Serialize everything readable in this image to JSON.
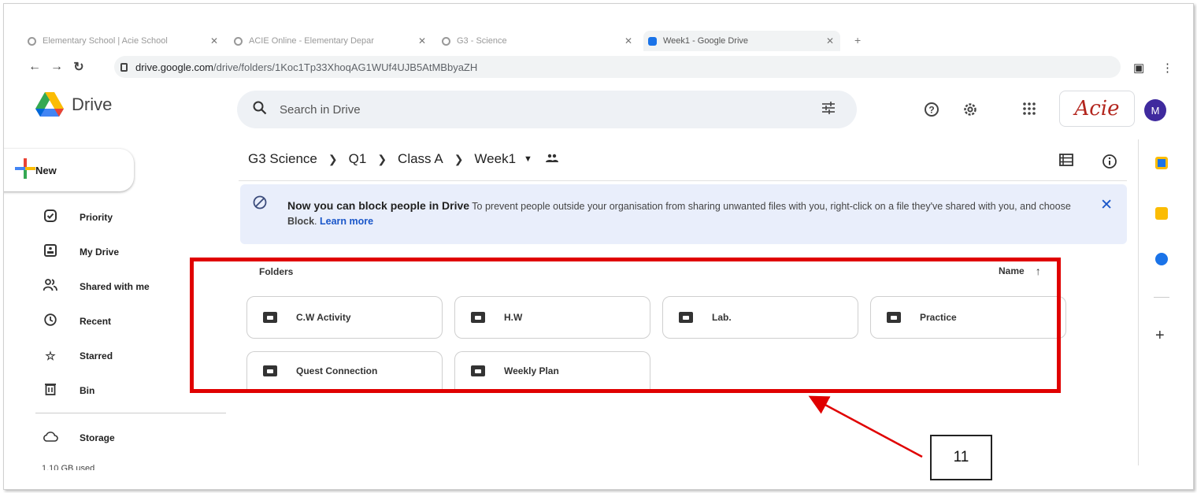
{
  "browser": {
    "tabs": [
      {
        "label": "Elementary School | Acie School"
      },
      {
        "label": "ACIE Online - Elementary Depar"
      },
      {
        "label": "G3 - Science"
      },
      {
        "label": "Week1 - Google Drive"
      }
    ],
    "url_host": "drive.google.com",
    "url_path": "/drive/folders/1Koc1Tp33XhoqAG1WUf4UJB5AtMBbyaZH"
  },
  "header": {
    "app_name": "Drive",
    "search_placeholder": "Search in Drive",
    "brand_logo_text": "Acie",
    "avatar_initial": "M"
  },
  "sidebar": {
    "new_label": "New",
    "items": [
      {
        "label": "Priority",
        "icon": "priority-icon"
      },
      {
        "label": "My Drive",
        "icon": "my-drive-icon"
      },
      {
        "label": "Shared with me",
        "icon": "people-icon"
      },
      {
        "label": "Recent",
        "icon": "clock-icon"
      },
      {
        "label": "Starred",
        "icon": "star-icon"
      },
      {
        "label": "Bin",
        "icon": "trash-icon"
      }
    ],
    "storage_label": "Storage",
    "storage_used": "1.10 GB used"
  },
  "breadcrumb": [
    "G3 Science",
    "Q1",
    "Class A",
    "Week1"
  ],
  "banner": {
    "heading": "Now you can block people in Drive",
    "text_before": " To prevent people outside your organisation from sharing unwanted files with you, right-click on a file they've shared with you, and choose ",
    "bold_word": "Block",
    "text_after": ". ",
    "link": "Learn more"
  },
  "folders": {
    "section_label": "Folders",
    "sort_label": "Name",
    "items": [
      "C.W Activity",
      "H.W",
      "Lab.",
      "Practice",
      "Quest Connection",
      "Weekly Plan"
    ]
  },
  "annotation": {
    "callout_number": "11",
    "highlight_color": "#e00000"
  }
}
